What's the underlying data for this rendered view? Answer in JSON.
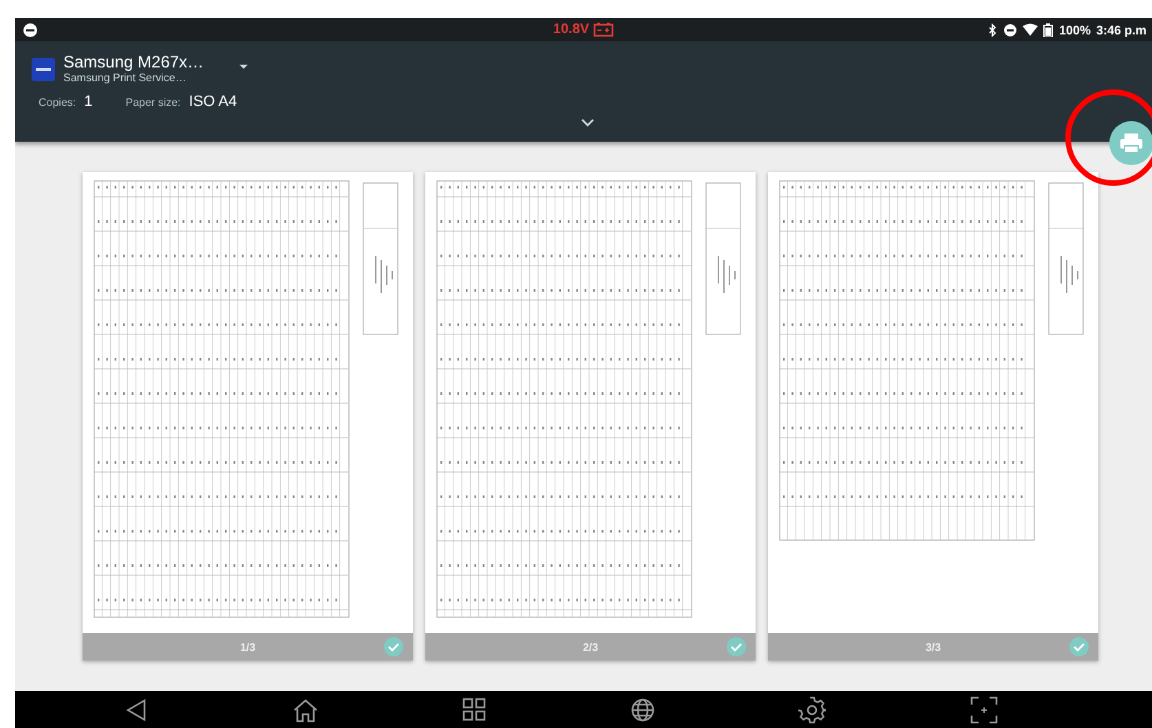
{
  "status_bar": {
    "voltage": "10.8V",
    "battery": "100%",
    "time": "3:46 p.m"
  },
  "printer": {
    "name": "Samsung M267x…",
    "service": "Samsung Print Service…"
  },
  "options": [
    {
      "label": "Copies:",
      "value": "1"
    },
    {
      "label": "Paper size:",
      "value": "ISO A4"
    }
  ],
  "pages": [
    {
      "label": "1/3",
      "selected": true,
      "kind": "full"
    },
    {
      "label": "2/3",
      "selected": true,
      "kind": "full"
    },
    {
      "label": "3/3",
      "selected": true,
      "kind": "partial"
    }
  ]
}
